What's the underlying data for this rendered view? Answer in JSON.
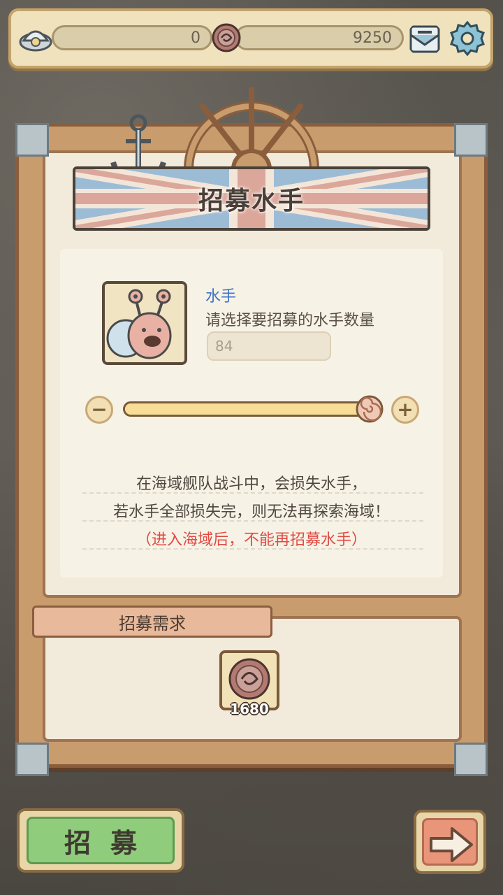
{
  "topbar": {
    "left_resource_value": "0",
    "right_resource_value": "9250",
    "left_icon": "helm-hat-icon",
    "coin_icon": "coin-icon",
    "mail_icon": "mail-icon",
    "settings_icon": "gear-icon"
  },
  "panel": {
    "title": "招募水手",
    "unit_name": "水手",
    "prompt": "请选择要招募的水手数量",
    "quantity": "84",
    "slider_fraction": 1.0,
    "info_line1": "在海域舰队战斗中，会损失水手，",
    "info_line2": "若水手全部损失完，则无法再探索海域！",
    "warning": "（进入海域后，不能再招募水手）"
  },
  "requirements": {
    "label": "招募需求",
    "cost_amount": "1680",
    "cost_icon": "coin-icon"
  },
  "actions": {
    "recruit_label": "招募",
    "next_icon": "arrow-right-icon"
  },
  "colors": {
    "link_blue": "#3c73c9",
    "warning_red": "#e14a44",
    "button_green": "#8fcc7c",
    "button_salmon": "#e8957a"
  }
}
